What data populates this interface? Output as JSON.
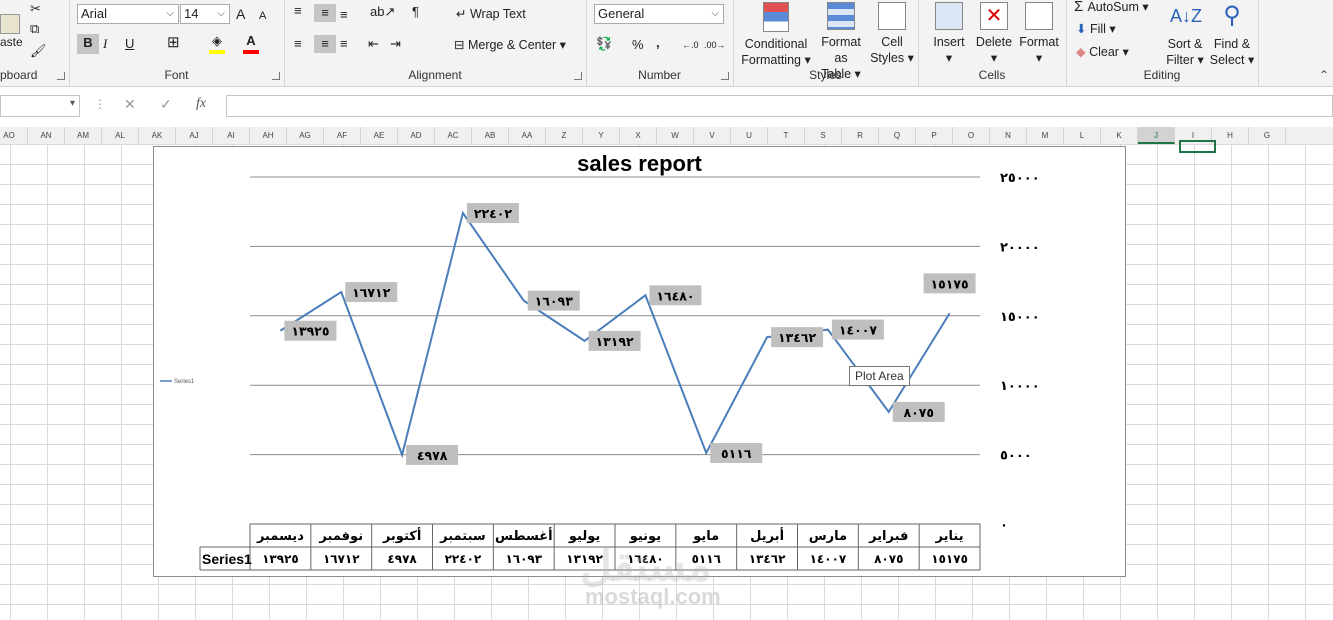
{
  "ribbon": {
    "clipboard": {
      "label": "pboard",
      "paste": "aste"
    },
    "font": {
      "label": "Font",
      "name": "Arial",
      "size": "14",
      "bold": "B",
      "italic": "I",
      "underline": "U",
      "grow": "A",
      "shrink": "A"
    },
    "alignment": {
      "label": "Alignment",
      "wrap_text": "Wrap Text",
      "merge_center": "Merge & Center"
    },
    "number": {
      "label": "Number",
      "format": "General",
      "percent": "%",
      "comma": ","
    },
    "styles": {
      "label": "Styles",
      "conditional": [
        "Conditional",
        "Formatting"
      ],
      "format_table": [
        "Format as",
        "Table"
      ],
      "cell_styles": [
        "Cell",
        "Styles"
      ]
    },
    "cells": {
      "label": "Cells",
      "insert": "Insert",
      "delete": "Delete",
      "format": "Format"
    },
    "editing": {
      "label": "Editing",
      "autosum": "AutoSum",
      "fill": "Fill",
      "clear": "Clear",
      "sort_filter": [
        "Sort &",
        "Filter"
      ],
      "find_select": [
        "Find &",
        "Select"
      ]
    }
  },
  "formula_bar": {
    "fx": "fx",
    "cancel": "✕",
    "enter": "✓",
    "value": ""
  },
  "columns": [
    "AO",
    "AN",
    "AM",
    "AL",
    "AK",
    "AJ",
    "AI",
    "AH",
    "AG",
    "AF",
    "AE",
    "AD",
    "AC",
    "AB",
    "AA",
    "Z",
    "Y",
    "X",
    "W",
    "V",
    "U",
    "T",
    "S",
    "R",
    "Q",
    "P",
    "O",
    "N",
    "M",
    "L",
    "K",
    "J",
    "I",
    "H",
    "G"
  ],
  "selected_column": "J",
  "tooltip": "Plot Area",
  "watermark": {
    "logo": "مستقل",
    "site": "mostaql.com"
  },
  "chart_data": {
    "type": "line",
    "title": "sales report",
    "categories": [
      "يناير",
      "فبراير",
      "مارس",
      "أبريل",
      "مايو",
      "يونيو",
      "يوليو",
      "أغسطس",
      "سبتمبر",
      "أكتوبر",
      "نوفمبر",
      "ديسمبر"
    ],
    "series": [
      {
        "name": "Series1",
        "values": [
          15175,
          8075,
          14007,
          13462,
          5116,
          16480,
          13192,
          16093,
          22402,
          4978,
          16712,
          13925
        ],
        "value_labels": [
          "١٥١٧٥",
          "٨٠٧٥",
          "١٤٠٠٧",
          "١٣٤٦٢",
          "٥١١٦",
          "١٦٤٨٠",
          "١٣١٩٢",
          "١٦٠٩٣",
          "٢٢٤٠٢",
          "٤٩٧٨",
          "١٦٧١٢",
          "١٣٩٢٥"
        ],
        "color": "#4a7ebb"
      }
    ],
    "ylim": [
      0,
      25000
    ],
    "y_ticks": [
      0,
      5000,
      10000,
      15000,
      20000,
      25000
    ],
    "y_tick_labels": [
      "٠",
      "٥٠٠٠",
      "١٠٠٠٠",
      "١٥٠٠٠",
      "٢٠٠٠٠",
      "٢٥٠٠٠"
    ],
    "x_axis_reversed": true,
    "y_axis_position": "right",
    "grid": true,
    "legend": "left",
    "data_table": true,
    "data_label_bg": "#bfbfbf"
  }
}
